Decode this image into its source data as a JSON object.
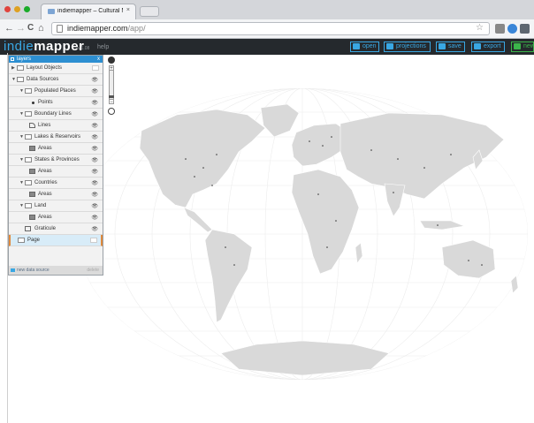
{
  "browser": {
    "tab_title": "indiemapper – Cultural Map",
    "tab_close": "×",
    "nav": {
      "back": "←",
      "forward": "→",
      "reload": "C",
      "home": "⌂"
    },
    "url_host": "indiemapper.com",
    "url_path": "/app/",
    "star": "☆"
  },
  "app": {
    "logo_indie": "indie",
    "logo_mapper": "mapper",
    "version": "v.1.08",
    "help": "help",
    "buttons": [
      {
        "label": "open"
      },
      {
        "label": "projections"
      },
      {
        "label": "save"
      },
      {
        "label": "export"
      },
      {
        "label": "new"
      }
    ],
    "accent": "#39a7e3",
    "new_color": "#3bb54a"
  },
  "panel": {
    "title": "layers",
    "close": "x",
    "rows": [
      {
        "label": "Layout Objects",
        "icon": "folder-icon",
        "depth": 0,
        "expander": "▶"
      },
      {
        "label": "Data Sources",
        "icon": "folder-icon",
        "depth": 0,
        "expander": "▼"
      },
      {
        "label": "Populated Places",
        "icon": "layer-group-icon",
        "depth": 1,
        "expander": "▼"
      },
      {
        "label": "Points",
        "icon": "point-icon",
        "depth": 2
      },
      {
        "label": "Boundary Lines",
        "icon": "layer-group-icon",
        "depth": 1,
        "expander": "▼"
      },
      {
        "label": "Lines",
        "icon": "line-icon",
        "depth": 2
      },
      {
        "label": "Lakes & Reservoirs",
        "icon": "layer-group-icon",
        "depth": 1,
        "expander": "▼"
      },
      {
        "label": "Areas",
        "icon": "area-icon",
        "depth": 2
      },
      {
        "label": "States & Provinces",
        "icon": "layer-group-icon",
        "depth": 1,
        "expander": "▼"
      },
      {
        "label": "Areas",
        "icon": "area-icon",
        "depth": 2
      },
      {
        "label": "Countries",
        "icon": "layer-group-icon",
        "depth": 1,
        "expander": "▼"
      },
      {
        "label": "Areas",
        "icon": "area-icon",
        "depth": 2
      },
      {
        "label": "Land",
        "icon": "layer-group-icon",
        "depth": 1,
        "expander": "▼"
      },
      {
        "label": "Areas",
        "icon": "area-icon",
        "depth": 2
      },
      {
        "label": "Graticule",
        "icon": "graticule-icon",
        "depth": 1
      },
      {
        "label": "Page",
        "icon": "page-icon",
        "depth": 0,
        "selected": true
      }
    ],
    "footer_label": "new data source",
    "footer_delete": "delete",
    "eye": "👁"
  },
  "map": {
    "zoom_in": "+",
    "zoom_out": "−",
    "land_color": "#d9d9d9",
    "border_color": "#ffffff",
    "graticule_color": "#ececec"
  }
}
